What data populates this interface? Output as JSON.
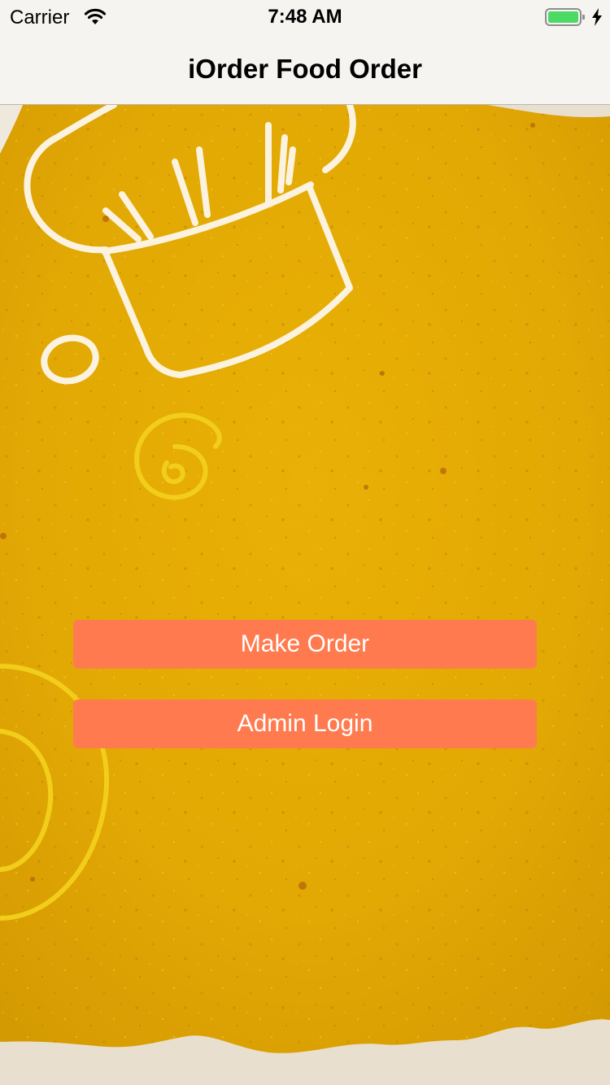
{
  "status_bar": {
    "carrier": "Carrier",
    "time": "7:48 AM",
    "wifi_icon": "wifi-icon",
    "battery_icon": "battery-icon",
    "charging_icon": "charging-bolt-icon",
    "battery_color": "#4cd964"
  },
  "nav_bar": {
    "title": "iOrder Food Order"
  },
  "background": {
    "description_icon": "chef-hat-illustration",
    "paper_color": "#e4a800",
    "torn_edge_color": "#e9dfcf"
  },
  "buttons": {
    "make_order": "Make Order",
    "admin_login": "Admin Login",
    "color": "#ff7b4f"
  }
}
